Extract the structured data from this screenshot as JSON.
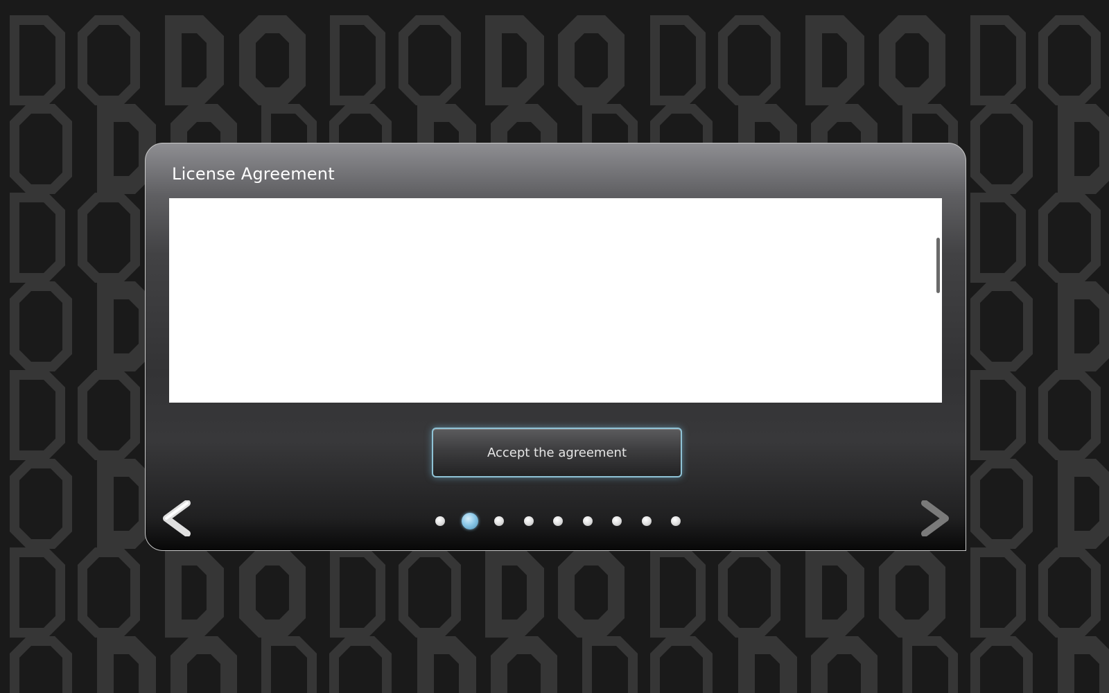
{
  "dialog": {
    "title": "License Agreement",
    "body_text": "",
    "accept_label": "Accept the agreement"
  },
  "navigation": {
    "prev_icon": "chevron-left-icon",
    "next_icon": "chevron-right-icon"
  },
  "pager": {
    "page_count": 9,
    "active_page": 2
  },
  "background": {
    "pattern_letters": [
      "D",
      "O"
    ],
    "base_color": "#1a1a1a",
    "letter_color": "#3a3a3a"
  },
  "colors": {
    "accent": "#8cc8e8",
    "button_glow": "#8fc3d6",
    "dialog_border": "#c9c9c9"
  }
}
